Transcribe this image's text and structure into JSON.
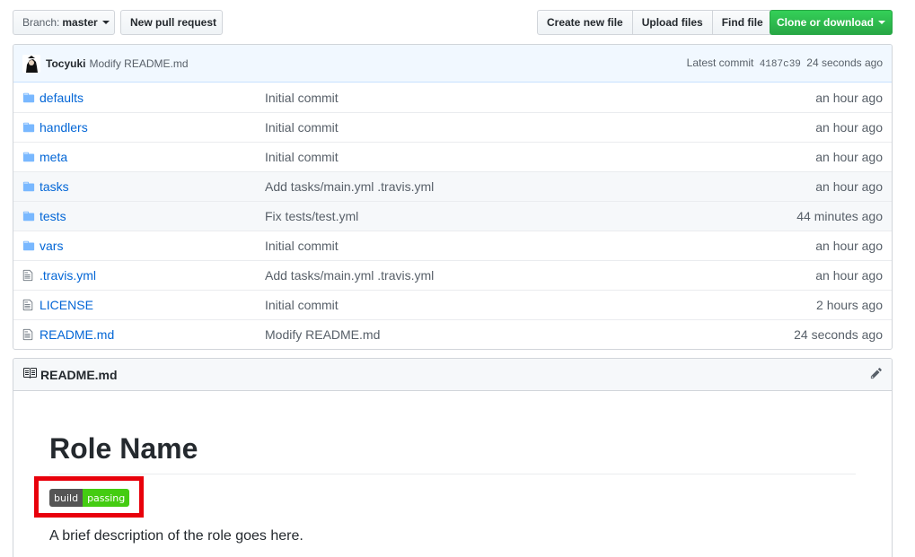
{
  "toolbar": {
    "branch_prefix": "Branch:",
    "branch_name": "master",
    "new_pr": "New pull request",
    "create_file": "Create new file",
    "upload_files": "Upload files",
    "find_file": "Find file",
    "clone": "Clone or download"
  },
  "commit": {
    "author": "Tocyuki",
    "message": "Modify README.md",
    "latest_label": "Latest commit",
    "sha": "4187c39",
    "age": "24 seconds ago"
  },
  "files": [
    {
      "name": "defaults",
      "type": "dir",
      "message": "Initial commit",
      "age": "an hour ago"
    },
    {
      "name": "handlers",
      "type": "dir",
      "message": "Initial commit",
      "age": "an hour ago"
    },
    {
      "name": "meta",
      "type": "dir",
      "message": "Initial commit",
      "age": "an hour ago"
    },
    {
      "name": "tasks",
      "type": "dir",
      "message": "Add tasks/main.yml .travis.yml",
      "age": "an hour ago"
    },
    {
      "name": "tests",
      "type": "dir",
      "message": "Fix tests/test.yml",
      "age": "44 minutes ago"
    },
    {
      "name": "vars",
      "type": "dir",
      "message": "Initial commit",
      "age": "an hour ago"
    },
    {
      "name": ".travis.yml",
      "type": "file",
      "message": "Add tasks/main.yml .travis.yml",
      "age": "an hour ago"
    },
    {
      "name": "LICENSE",
      "type": "file",
      "message": "Initial commit",
      "age": "2 hours ago"
    },
    {
      "name": "README.md",
      "type": "file",
      "message": "Modify README.md",
      "age": "24 seconds ago"
    }
  ],
  "readme": {
    "filename": "README.md",
    "heading": "Role Name",
    "badge_left": "build",
    "badge_right": "passing",
    "description": "A brief description of the role goes here."
  },
  "colors": {
    "link": "#0366d6",
    "clone_green": "#28a745",
    "badge_green": "#44cc11",
    "highlight_red": "#e8000b"
  },
  "icons": {
    "dir": "folder-icon",
    "file": "file-text-icon",
    "readme": "book-icon",
    "edit": "pencil-icon"
  }
}
